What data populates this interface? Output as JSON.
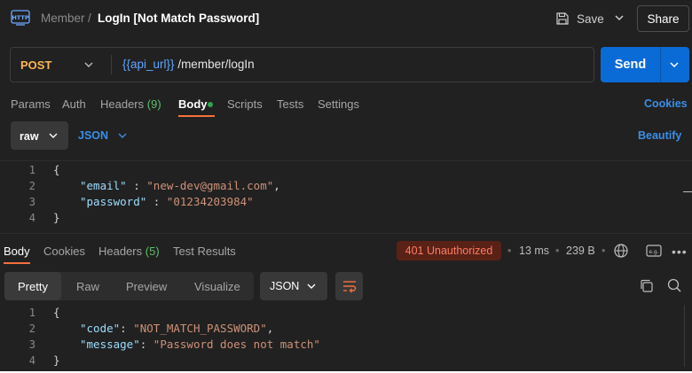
{
  "header": {
    "breadcrumb_parent": "Member",
    "breadcrumb_sep": "/",
    "title": "LogIn [Not Match Password]",
    "save_label": "Save",
    "share_label": "Share"
  },
  "request": {
    "method": "POST",
    "url_variable": "{{api_url}}",
    "url_path": " /member/logIn",
    "send_label": "Send"
  },
  "request_tabs": {
    "params": "Params",
    "auth": "Auth",
    "headers": "Headers",
    "headers_count": "(9)",
    "body": "Body",
    "scripts": "Scripts",
    "tests": "Tests",
    "settings": "Settings",
    "cookies": "Cookies"
  },
  "body_options": {
    "mode": "raw",
    "language": "JSON",
    "beautify": "Beautify"
  },
  "request_body": {
    "line_numbers": [
      "1",
      "2",
      "3",
      "4"
    ],
    "open": "{",
    "email_key": "\"email\"",
    "email_sep": " : ",
    "email_value": "\"new-dev@gmail.com\"",
    "email_comma": ",",
    "password_key": "\"password\"",
    "password_sep": " : ",
    "password_value": "\"01234203984\"",
    "close": "}"
  },
  "response_tabs": {
    "body": "Body",
    "cookies": "Cookies",
    "headers": "Headers",
    "headers_count": "(5)",
    "test_results": "Test Results"
  },
  "response_meta": {
    "status": "401 Unauthorized",
    "sep": "•",
    "time": "13 ms",
    "size": "239 B",
    "more": "•••"
  },
  "response_view": {
    "pretty": "Pretty",
    "raw": "Raw",
    "preview": "Preview",
    "visualize": "Visualize",
    "format": "JSON"
  },
  "response_body": {
    "line_numbers": [
      "1",
      "2",
      "3",
      "4"
    ],
    "open": "{",
    "code_key": "\"code\"",
    "code_sep": ": ",
    "code_value": "\"NOT_MATCH_PASSWORD\"",
    "code_comma": ",",
    "message_key": "\"message\"",
    "message_sep": ": ",
    "message_value": "\"Password does not match\"",
    "close": "}"
  },
  "colors": {
    "accent": "#f5703b",
    "send": "#0b6bd6",
    "method": "#fdb750",
    "status_error": "#ff7b63",
    "link": "#3a8fe8"
  },
  "icons": [
    "http-icon",
    "save-icon",
    "chevron-down-icon",
    "globe-icon",
    "example-icon",
    "wrap-icon",
    "copy-icon",
    "search-icon"
  ]
}
